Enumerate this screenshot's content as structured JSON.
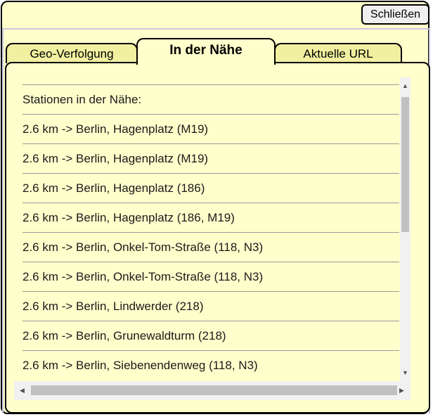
{
  "window": {
    "close_label": "Schließen"
  },
  "tabs": [
    {
      "label": "Geo-Verfolgung",
      "active": false
    },
    {
      "label": "In der Nähe",
      "active": true
    },
    {
      "label": "Aktuelle URL",
      "active": false
    }
  ],
  "list": {
    "heading": "Stationen in der Nähe:",
    "items": [
      "2.6 km -> Berlin, Hagenplatz (M19)",
      "2.6 km -> Berlin, Hagenplatz (M19)",
      "2.6 km -> Berlin, Hagenplatz (186)",
      "2.6 km -> Berlin, Hagenplatz (186, M19)",
      "2.6 km -> Berlin, Onkel-Tom-Straße (118, N3)",
      "2.6 km -> Berlin, Onkel-Tom-Straße (118, N3)",
      "2.6 km -> Berlin, Lindwerder (218)",
      "2.6 km -> Berlin, Grunewaldturm (218)",
      "2.6 km -> Berlin, Siebenendenweg (118, N3)"
    ]
  },
  "icons": {
    "scroll_up": "arrow-up-icon",
    "scroll_down": "arrow-down-icon",
    "scroll_left": "arrow-left-icon",
    "scroll_right": "arrow-right-icon"
  },
  "colors": {
    "background": "#ffffcc",
    "inactive_tab": "#f0f0a0",
    "border": "#000000",
    "scrollbar_track": "#f1f1f1",
    "scrollbar_thumb": "#c1c1c1"
  }
}
